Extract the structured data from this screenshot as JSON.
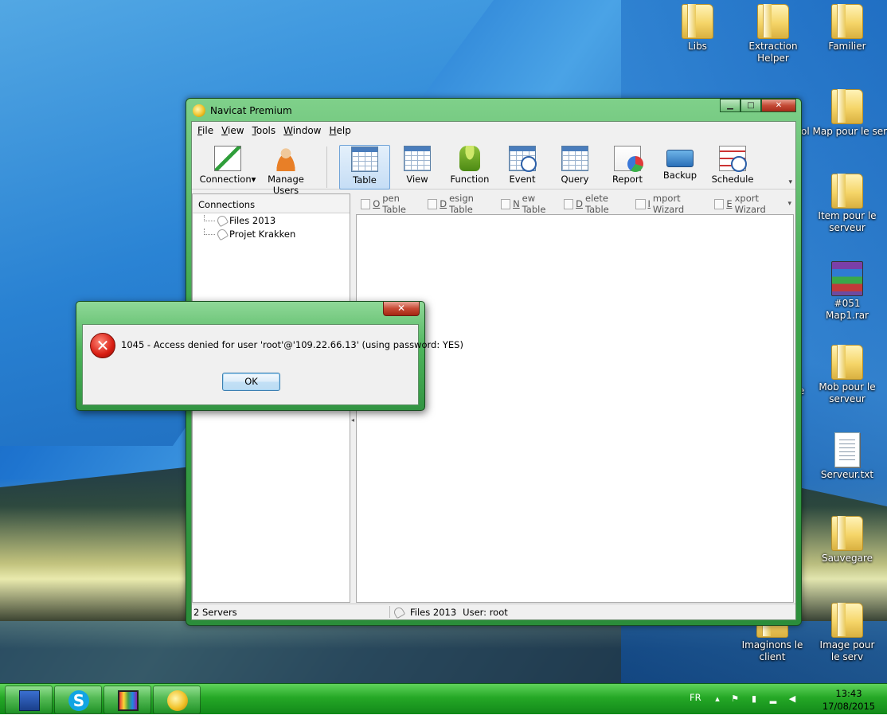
{
  "desktop": {
    "icons": [
      {
        "label": "Libs",
        "type": "folder"
      },
      {
        "label": "Extraction Helper",
        "type": "folder"
      },
      {
        "label": "Familier",
        "type": "folder"
      },
      {
        "label": "ol Map pour le serv",
        "type": "folder"
      },
      {
        "label": "Item pour le serveur",
        "type": "folder"
      },
      {
        "label": "#051 Map1.rar",
        "type": "rar"
      },
      {
        "label": "Mob pour le serveur",
        "type": "folder"
      },
      {
        "label": "Serveur.txt",
        "type": "text"
      },
      {
        "label": "Sauvegare",
        "type": "folder"
      },
      {
        "label": "Imaginons le client",
        "type": "folder"
      },
      {
        "label": "Image pour le serv",
        "type": "folder"
      }
    ],
    "partial_labels": {
      "le": "le",
      "r": "r"
    }
  },
  "window": {
    "title": "Navicat Premium",
    "controls": {
      "minimize": "▁",
      "maximize": "□",
      "close": "✕"
    },
    "menu": [
      {
        "key": "F",
        "rest": "ile"
      },
      {
        "key": "V",
        "rest": "iew"
      },
      {
        "key": "T",
        "rest": "ools"
      },
      {
        "key": "W",
        "rest": "indow"
      },
      {
        "key": "H",
        "rest": "elp"
      }
    ],
    "toolbar": {
      "connection": "Connection",
      "manage_users": "Manage Users",
      "table": "Table",
      "view": "View",
      "function": "Function",
      "event": "Event",
      "query": "Query",
      "report": "Report",
      "backup": "Backup",
      "schedule": "Schedule",
      "active": "Table"
    },
    "connections": {
      "header": "Connections",
      "items": [
        "Files 2013",
        "Projet Krakken"
      ]
    },
    "object_toolbar": [
      {
        "key": "O",
        "rest": "pen Table"
      },
      {
        "key": "D",
        "rest": "esign Table"
      },
      {
        "key": "N",
        "rest": "ew Table"
      },
      {
        "key": "D",
        "rest": "elete Table"
      },
      {
        "key": "I",
        "rest": "mport Wizard"
      },
      {
        "key": "E",
        "rest": "xport Wizard"
      }
    ],
    "status": {
      "servers": "2 Servers",
      "connection": "Files 2013",
      "user": "User: root"
    }
  },
  "dialog": {
    "close": "✕",
    "message": "1045 - Access denied for user 'root'@'109.22.66.13' (using password: YES)",
    "ok": "OK"
  },
  "taskbar": {
    "apps": [
      "network-app",
      "skype",
      "movie-maker",
      "navicat"
    ],
    "language": "FR",
    "time": "13:43",
    "date": "17/08/2015"
  }
}
